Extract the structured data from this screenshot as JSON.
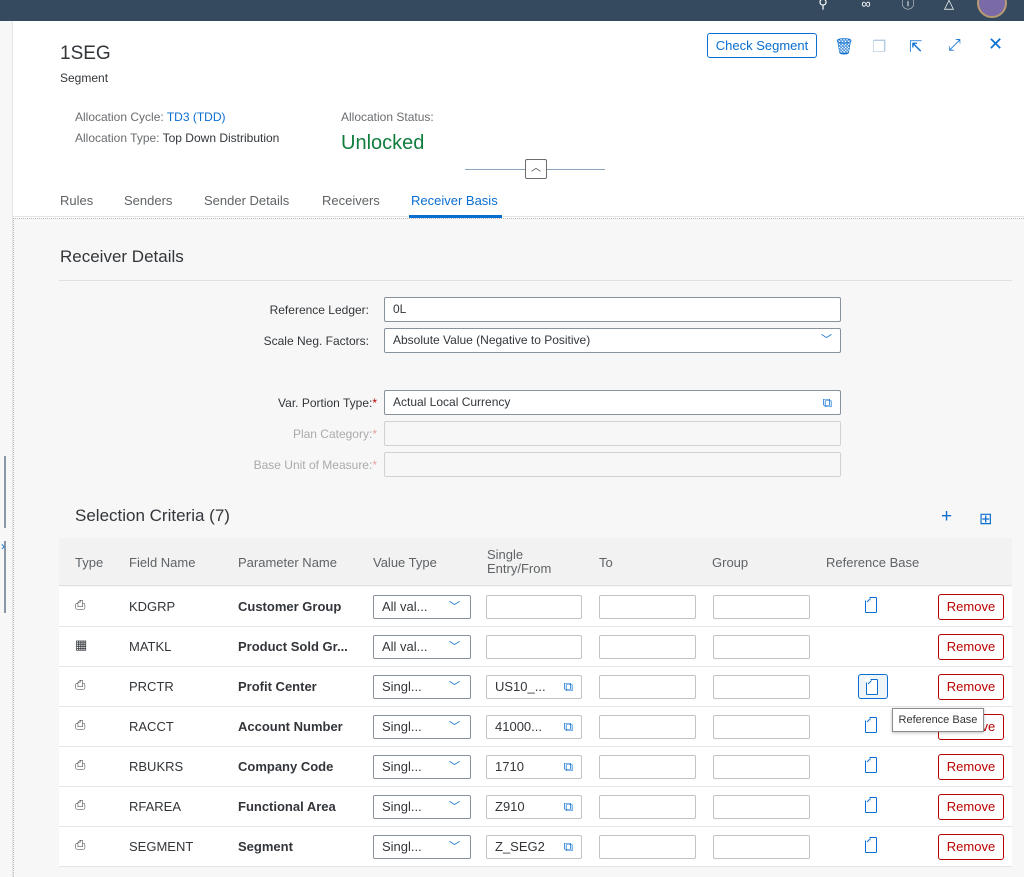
{
  "shellbar": {
    "icons": [
      "search-icon",
      "binoculars-icon",
      "help-icon",
      "bell-icon"
    ],
    "colors": {
      "bar": "#354a5f"
    }
  },
  "header": {
    "title": "1SEG",
    "subtitle": "Segment",
    "allocation_cycle_label": "Allocation Cycle:",
    "allocation_cycle_value": "TD3 (TDD)",
    "allocation_type_label": "Allocation Type:",
    "allocation_type_value": "Top Down Distribution",
    "allocation_status_label": "Allocation Status:",
    "allocation_status_value": "Unlocked",
    "actions": {
      "check_segment": "Check Segment",
      "icons": [
        "delete-icon",
        "copy-icon",
        "share-icon",
        "fullscreen-icon",
        "close-icon"
      ]
    }
  },
  "tabs": [
    {
      "label": "Rules",
      "active": false
    },
    {
      "label": "Senders",
      "active": false
    },
    {
      "label": "Sender Details",
      "active": false
    },
    {
      "label": "Receivers",
      "active": false
    },
    {
      "label": "Receiver Basis",
      "active": true
    }
  ],
  "receiver_details": {
    "title": "Receiver Details",
    "reference_ledger_label": "Reference Ledger:",
    "reference_ledger_value": "0L",
    "scale_neg_factors_label": "Scale Neg. Factors:",
    "scale_neg_factors_value": "Absolute Value (Negative to Positive)",
    "var_portion_type_label": "Var. Portion Type:",
    "var_portion_type_value": "Actual Local Currency",
    "plan_category_label": "Plan Category:",
    "plan_category_value": "",
    "base_uom_label": "Base Unit of Measure:",
    "base_uom_value": "",
    "required_marker": "*"
  },
  "selection_criteria": {
    "title": "Selection Criteria (7)",
    "columns": {
      "type": "Type",
      "field_name": "Field Name",
      "parameter_name": "Parameter Name",
      "value_type": "Value Type",
      "single_entry_line1": "Single",
      "single_entry_line2": "Entry/From",
      "to": "To",
      "group": "Group",
      "reference_base": "Reference Base"
    },
    "remove_label": "Remove",
    "rows": [
      {
        "type_icon": "document-icon",
        "field": "KDGRP",
        "parameter": "Customer Group",
        "value_type": "All val...",
        "from": "",
        "to": "",
        "group": "",
        "has_reference": true
      },
      {
        "type_icon": "table-icon",
        "field": "MATKL",
        "parameter": "Product Sold Gr...",
        "value_type": "All val...",
        "from": "",
        "to": "",
        "group": "",
        "has_reference": false
      },
      {
        "type_icon": "document-icon",
        "field": "PRCTR",
        "parameter": "Profit Center",
        "value_type": "Singl...",
        "from": "US10_...",
        "to": "",
        "group": "",
        "has_reference": true,
        "reference_focused": true
      },
      {
        "type_icon": "document-icon",
        "field": "RACCT",
        "parameter": "Account Number",
        "value_type": "Singl...",
        "from": "41000...",
        "to": "",
        "group": "",
        "has_reference": true
      },
      {
        "type_icon": "document-icon",
        "field": "RBUKRS",
        "parameter": "Company Code",
        "value_type": "Singl...",
        "from": "1710",
        "to": "",
        "group": "",
        "has_reference": true
      },
      {
        "type_icon": "document-icon",
        "field": "RFAREA",
        "parameter": "Functional Area",
        "value_type": "Singl...",
        "from": "Z910",
        "to": "",
        "group": "",
        "has_reference": true
      },
      {
        "type_icon": "document-icon",
        "field": "SEGMENT",
        "parameter": "Segment",
        "value_type": "Singl...",
        "from": "Z_SEG2",
        "to": "",
        "group": "",
        "has_reference": true
      }
    ]
  },
  "tooltip": {
    "text": "Reference Base"
  },
  "colors": {
    "accent": "#0a6ed1",
    "positive": "#107e3e",
    "negative": "#bb0000"
  }
}
